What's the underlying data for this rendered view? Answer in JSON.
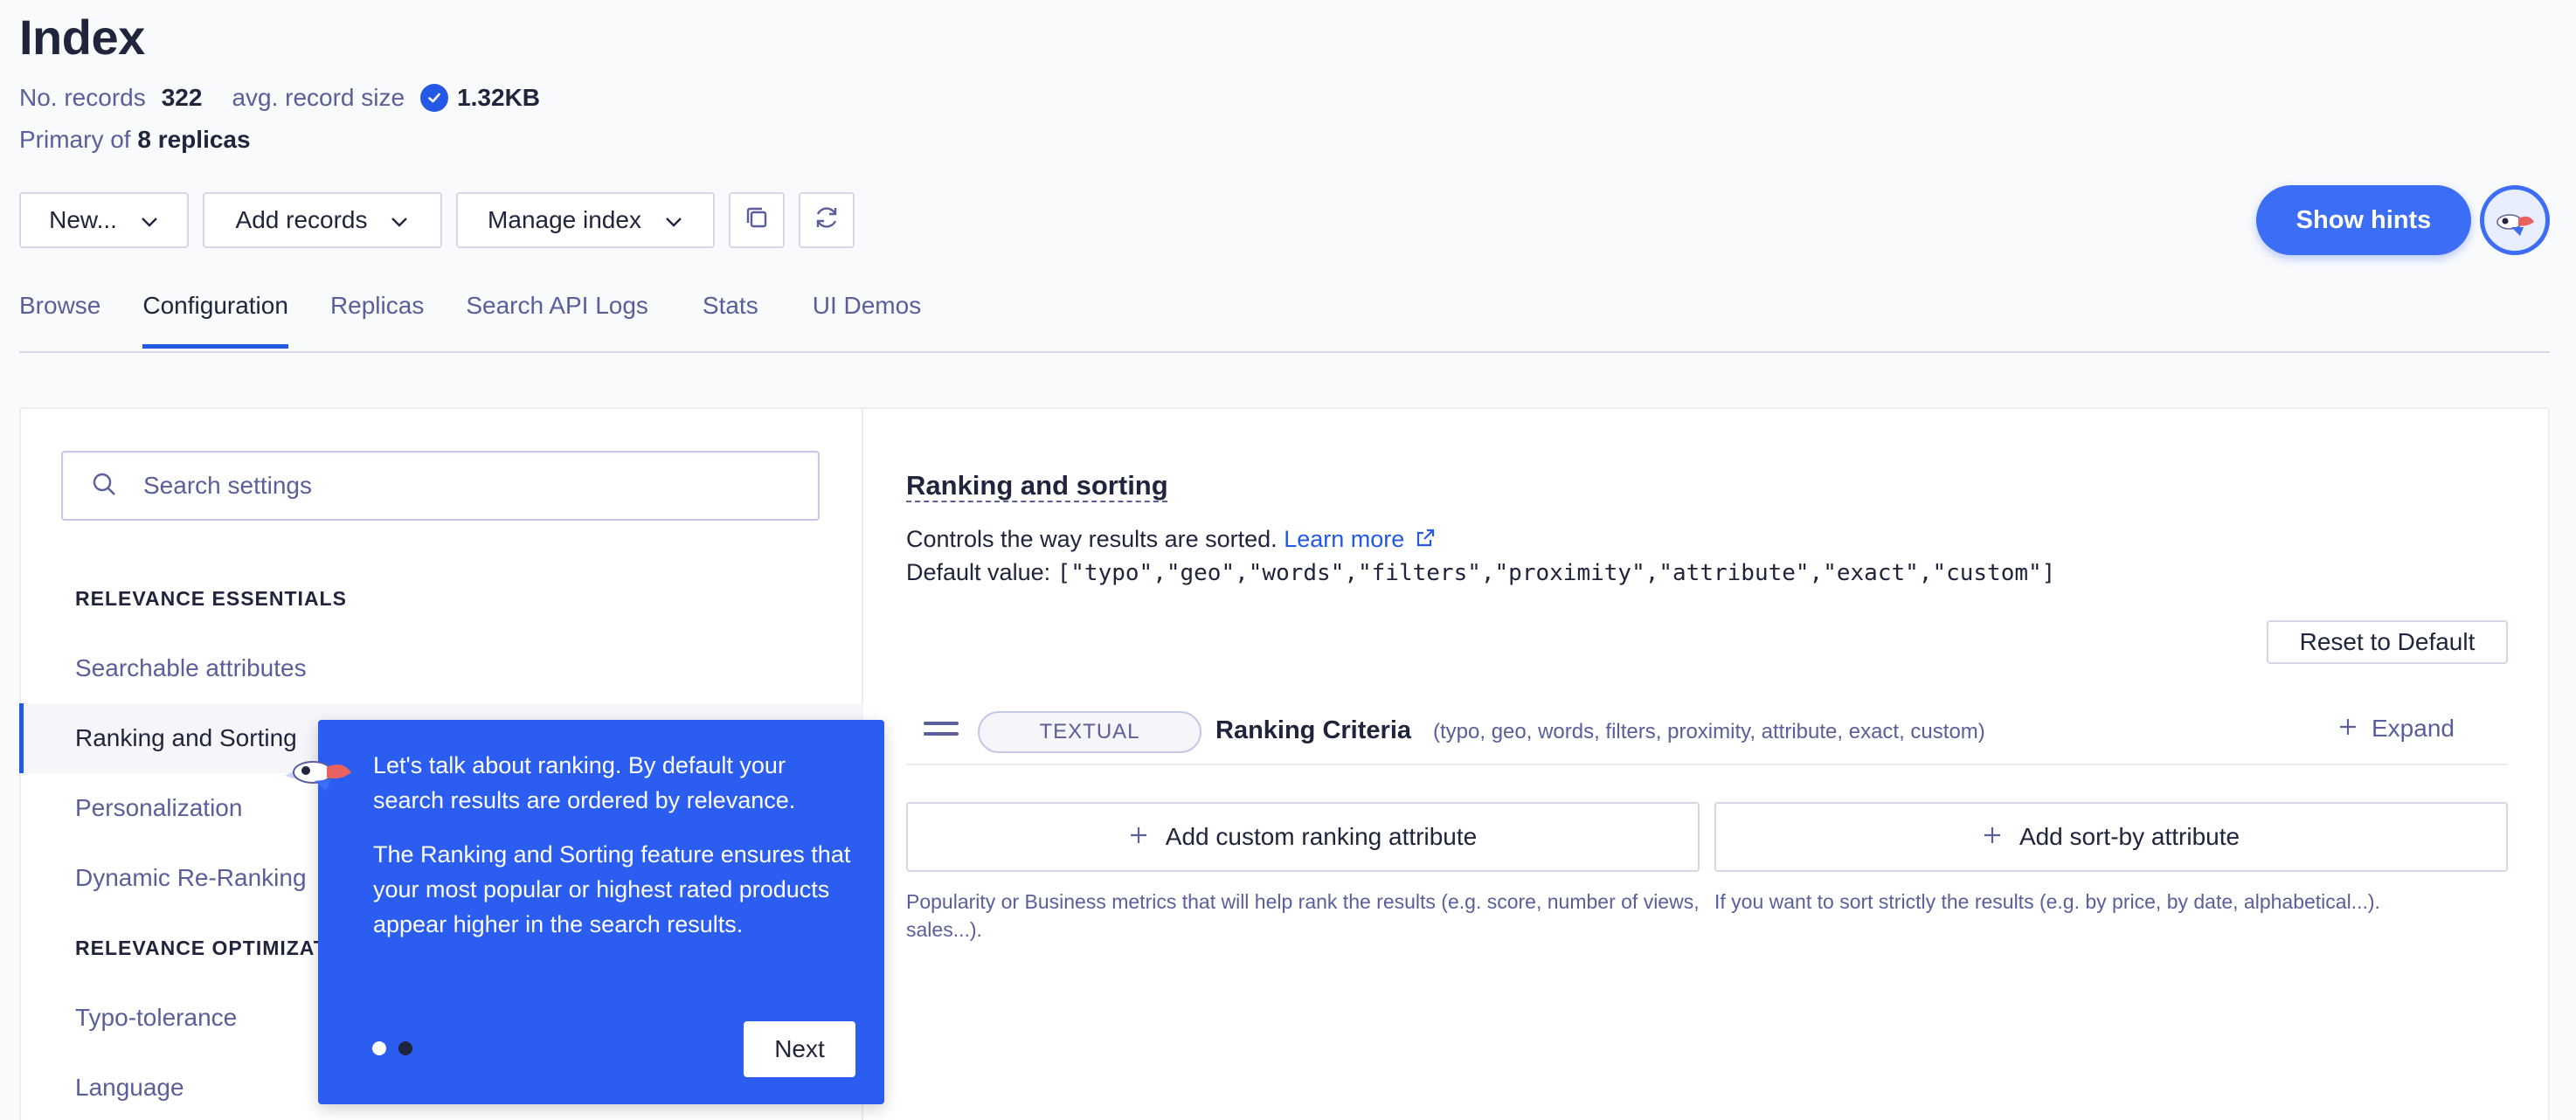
{
  "header": {
    "title": "Index",
    "records_label": "No. records",
    "records_value": "322",
    "avg_size_label": "avg. record size",
    "avg_size_value": "1.32KB",
    "primary_prefix": "Primary of",
    "replicas": "8 replicas"
  },
  "toolbar": {
    "new_label": "New...",
    "add_records_label": "Add records",
    "manage_index_label": "Manage index",
    "copy_icon": "copy-icon",
    "refresh_icon": "refresh-icon",
    "show_hints_label": "Show hints"
  },
  "tabs": [
    {
      "label": "Browse"
    },
    {
      "label": "Configuration"
    },
    {
      "label": "Replicas"
    },
    {
      "label": "Search API Logs"
    },
    {
      "label": "Stats"
    },
    {
      "label": "UI Demos"
    }
  ],
  "sidebar": {
    "search_placeholder": "Search settings",
    "sections": [
      {
        "title": "RELEVANCE ESSENTIALS"
      },
      {
        "title": "RELEVANCE OPTIMIZATIONS"
      }
    ],
    "items": [
      {
        "label": "Searchable attributes"
      },
      {
        "label": "Ranking and Sorting"
      },
      {
        "label": "Personalization"
      },
      {
        "label": "Dynamic Re-Ranking"
      },
      {
        "label": "Typo-tolerance"
      },
      {
        "label": "Language"
      }
    ]
  },
  "main": {
    "title": "Ranking and sorting",
    "description": "Controls the way results are sorted.",
    "learn_more": "Learn more",
    "default_prefix": "Default value:",
    "default_value": "[\"typo\",\"geo\",\"words\",\"filters\",\"proximity\",\"attribute\",\"exact\",\"custom\"]",
    "reset_label": "Reset to Default",
    "criteria": {
      "badge": "TEXTUAL",
      "name": "Ranking Criteria",
      "list": "(typo, geo, words, filters, proximity, attribute, exact, custom)",
      "expand_label": "Expand"
    },
    "add_custom_label": "Add custom ranking attribute",
    "add_sort_label": "Add sort-by attribute",
    "custom_help": "Popularity or Business metrics that will help rank the results (e.g. score, number of views, sales...).",
    "sort_help": "If you want to sort strictly the results (e.g. by price, by date, alphabetical...)."
  },
  "tooltip": {
    "paragraph1": "Let's talk about ranking. By default your search results are ordered by relevance.",
    "paragraph2": "The Ranking and Sorting feature ensures that your most popular or highest rated products appear higher in the search results.",
    "next_label": "Next",
    "step": 1,
    "total_steps": 2
  },
  "colors": {
    "accent": "#2459e5",
    "hint_button": "#3c6ef5",
    "tooltip_bg": "#2b5ef0",
    "text_primary": "#21243d",
    "text_secondary": "#5a5e9a"
  }
}
